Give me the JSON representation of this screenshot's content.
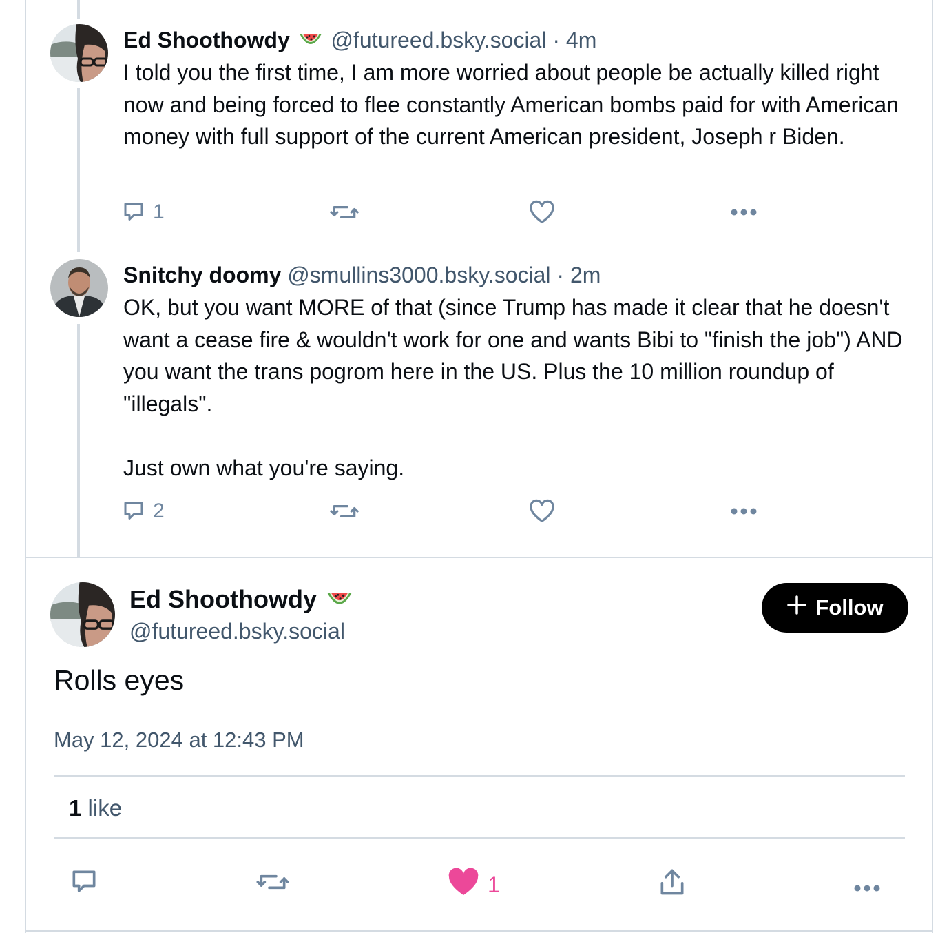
{
  "posts": [
    {
      "author_name": "Ed Shoothowdy",
      "name_emoji": "watermelon-emoji",
      "handle": "@futureed.bsky.social",
      "time": " · 4m",
      "text": "I told you the first time, I am more worried about people be actually killed right now and being forced to flee constantly American bombs paid for with American money with full support of the current American president, Joseph r Biden.",
      "reply_count": "1"
    },
    {
      "author_name": "Snitchy doomy",
      "handle": "@smullins3000.bsky.social",
      "time": " · 2m",
      "text": "OK, but you want MORE of that (since Trump has made it clear that he doesn't want a cease fire & wouldn't work for one and wants Bibi to \"finish the job\") AND you want the trans pogrom here in the US. Plus the 10 million roundup of \"illegals\".\n\nJust own what you're saying.",
      "reply_count": "2"
    }
  ],
  "main_post": {
    "author_name": "Ed Shoothowdy",
    "name_emoji": "watermelon-emoji",
    "handle": "@futureed.bsky.social",
    "follow_label": "Follow",
    "text": "Rolls eyes",
    "date": "May 12, 2024 at 12:43 PM",
    "like_stat_count": "1",
    "like_stat_label": "like",
    "like_count": "1"
  },
  "colors": {
    "text": "#0b0f14",
    "muted": "#42576c",
    "icon": "#6f869f",
    "divider": "#d4dbe2",
    "like": "#ec4899",
    "follow_bg": "#000000"
  }
}
